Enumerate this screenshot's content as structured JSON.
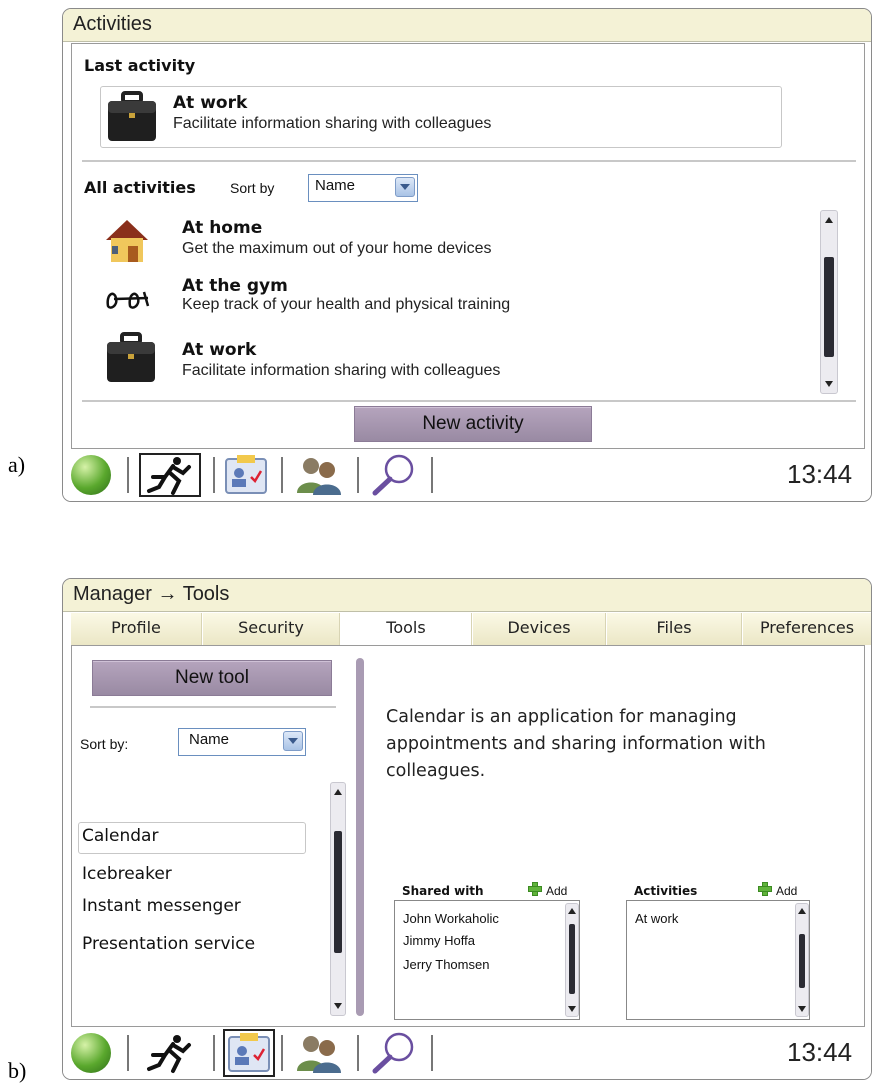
{
  "panel_a": {
    "label": "a)",
    "title": "Activities",
    "last_activity": {
      "heading": "Last activity",
      "item": {
        "title": "At work",
        "description": "Facilitate information sharing with colleagues",
        "icon": "briefcase-icon"
      }
    },
    "all_activities": {
      "heading": "All activities",
      "sort_label": "Sort by",
      "sort_value": "Name",
      "items": [
        {
          "title": "At home",
          "description": "Get the maximum out of your home devices",
          "icon": "house-icon"
        },
        {
          "title": "At the gym",
          "description": "Keep track of your health and physical training",
          "icon": "dumbbell-icon"
        },
        {
          "title": "At work",
          "description": "Facilitate information sharing with colleagues",
          "icon": "briefcase-icon"
        }
      ]
    },
    "new_button": "New activity",
    "taskbar": {
      "time": "13:44",
      "active_icon": "runner-icon"
    }
  },
  "panel_b": {
    "label": "b)",
    "title": "Manager → Tools",
    "tabs": [
      "Profile",
      "Security",
      "Tools",
      "Devices",
      "Files",
      "Preferences"
    ],
    "active_tab": "Tools",
    "new_button": "New tool",
    "sort_label": "Sort by:",
    "sort_value": "Name",
    "tools": [
      "Calendar",
      "Icebreaker",
      "Instant messenger",
      "Presentation service"
    ],
    "selected_tool": "Calendar",
    "description": "Calendar is an application for managing appointments and sharing information with colleagues.",
    "shared_with": {
      "heading": "Shared with",
      "add": "Add",
      "people": [
        "John Workaholic",
        "Jimmy Hoffa",
        "Jerry Thomsen"
      ]
    },
    "activities": {
      "heading": "Activities",
      "add": "Add",
      "items": [
        "At work"
      ]
    },
    "taskbar": {
      "time": "13:44",
      "active_icon": "contacts-card-icon"
    }
  },
  "colors": {
    "titlebar": "#f4f2d6",
    "button": "#a797b0",
    "scroll_thumb": "#2b2b33"
  }
}
